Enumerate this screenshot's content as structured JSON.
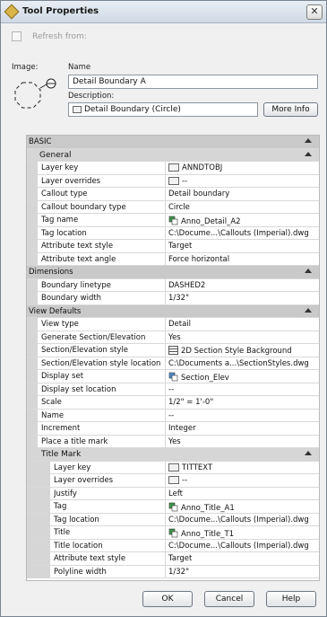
{
  "window": {
    "title": "Tool Properties",
    "close_label": "✕"
  },
  "refresh_label": "Refresh from:",
  "image_label": "Image:",
  "name_label": "Name",
  "name_value": "Detail Boundary A",
  "description_label": "Description:",
  "description_value": "Detail Boundary (Circle)",
  "more_info_label": "More Info",
  "sections": {
    "basic": "BASIC",
    "general": "General",
    "dimensions": "Dimensions",
    "view_defaults": "View Defaults",
    "title_mark": "Title Mark"
  },
  "general": [
    {
      "key": "Layer key",
      "value": "ANNDTOBJ",
      "icon": "layer-icon"
    },
    {
      "key": "Layer overrides",
      "value": "--",
      "icon": "layer-icon"
    },
    {
      "key": "Callout type",
      "value": "Detail boundary"
    },
    {
      "key": "Callout boundary type",
      "value": "Circle"
    },
    {
      "key": "Tag name",
      "value": "Anno_Detail_A2",
      "icon": "block-icon"
    },
    {
      "key": "Tag location",
      "value": "C:\\Docume...\\Callouts (Imperial).dwg"
    },
    {
      "key": "Attribute text style",
      "value": "Target"
    },
    {
      "key": "Attribute text angle",
      "value": "Force horizontal"
    }
  ],
  "dimensions": [
    {
      "key": "Boundary linetype",
      "value": "DASHED2"
    },
    {
      "key": "Boundary width",
      "value": "1/32\""
    }
  ],
  "view_defaults": [
    {
      "key": "View type",
      "value": "Detail"
    },
    {
      "key": "Generate Section/Elevation",
      "value": "Yes"
    },
    {
      "key": "Section/Elevation style",
      "value": "2D Section Style Background",
      "icon": "section-style-icon"
    },
    {
      "key": "Section/Elevation style location",
      "value": "C:\\Documents a...\\SectionStyles.dwg"
    },
    {
      "key": "Display set",
      "value": "Section_Elev",
      "icon": "display-set-icon"
    },
    {
      "key": "Display set location",
      "value": "--"
    },
    {
      "key": "Scale",
      "value": "1/2\" = 1'-0\""
    },
    {
      "key": "Name",
      "value": "--"
    },
    {
      "key": "Increment",
      "value": "Integer"
    },
    {
      "key": "Place a title mark",
      "value": "Yes"
    }
  ],
  "title_mark": [
    {
      "key": "Layer key",
      "value": "TITTEXT",
      "icon": "layer-icon"
    },
    {
      "key": "Layer overrides",
      "value": "--",
      "icon": "layer-icon"
    },
    {
      "key": "Justify",
      "value": "Left"
    },
    {
      "key": "Tag",
      "value": "Anno_Title_A1",
      "icon": "block-icon"
    },
    {
      "key": "Tag location",
      "value": "C:\\Docume...\\Callouts (Imperial).dwg"
    },
    {
      "key": "Title",
      "value": "Anno_Title_T1",
      "icon": "block-icon"
    },
    {
      "key": "Title location",
      "value": "C:\\Docume...\\Callouts (Imperial).dwg"
    },
    {
      "key": "Attribute text style",
      "value": "Target"
    },
    {
      "key": "Polyline width",
      "value": "1/32\""
    }
  ],
  "buttons": {
    "ok": "OK",
    "cancel": "Cancel",
    "help": "Help"
  }
}
